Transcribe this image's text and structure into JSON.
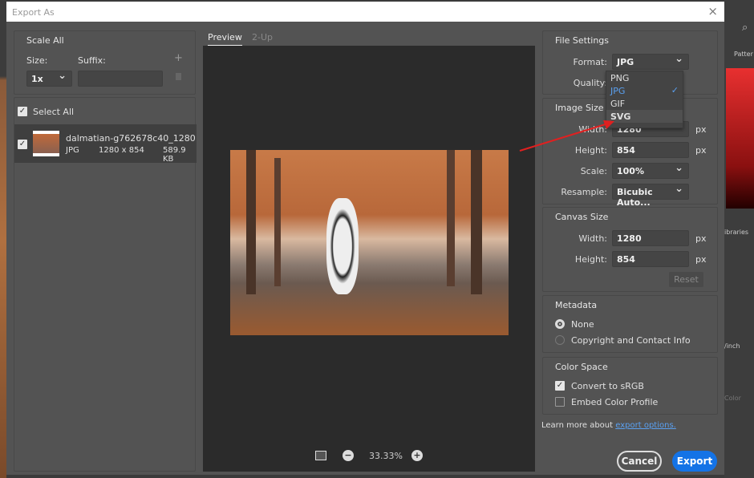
{
  "window": {
    "title": "Export As",
    "close_icon": "×"
  },
  "scale_all": {
    "title": "Scale All",
    "size_label": "Size:",
    "suffix_label": "Suffix:",
    "size_value": "1x",
    "suffix_value": "",
    "add_icon": "+"
  },
  "assets": {
    "select_all": "Select All",
    "items": [
      {
        "name": "dalmatian-g762678c40_1280",
        "format": "JPG",
        "dimensions": "1280 x 854",
        "size": "589.9 KB",
        "checked": true
      }
    ]
  },
  "preview": {
    "tabs": [
      {
        "label": "Preview",
        "active": true
      },
      {
        "label": "2-Up",
        "active": false
      }
    ],
    "zoom": "33.33%"
  },
  "file_settings": {
    "title": "File Settings",
    "format_label": "Format:",
    "format_value": "JPG",
    "quality_label": "Quality:",
    "format_options": [
      {
        "label": "PNG"
      },
      {
        "label": "JPG",
        "selected": true
      },
      {
        "label": "GIF"
      },
      {
        "label": "SVG",
        "hovered": true
      }
    ]
  },
  "image_size": {
    "title": "Image Size",
    "width_label": "Width:",
    "width_value": "1280",
    "height_label": "Height:",
    "height_value": "854",
    "unit": "px",
    "scale_label": "Scale:",
    "scale_value": "100%",
    "resample_label": "Resample:",
    "resample_value": "Bicubic Auto..."
  },
  "canvas_size": {
    "title": "Canvas Size",
    "width_label": "Width:",
    "width_value": "1280",
    "height_label": "Height:",
    "height_value": "854",
    "unit": "px",
    "reset": "Reset"
  },
  "metadata": {
    "title": "Metadata",
    "options": [
      {
        "label": "None",
        "selected": true
      },
      {
        "label": "Copyright and Contact Info",
        "selected": false
      }
    ]
  },
  "color_space": {
    "title": "Color Space",
    "options": [
      {
        "label": "Convert to sRGB",
        "checked": true
      },
      {
        "label": "Embed Color Profile",
        "checked": false
      }
    ]
  },
  "footer": {
    "learn_more": "Learn more about",
    "link": "export options.",
    "cancel": "Cancel",
    "export": "Export"
  },
  "background": {
    "tab_label": "Patter",
    "libraries": "ibraries",
    "inch": "/inch",
    "color": "Color"
  },
  "colors": {
    "accent": "#1473e6",
    "dropdown_selected": "#5aa0f0",
    "annotation_arrow": "#e02020"
  }
}
